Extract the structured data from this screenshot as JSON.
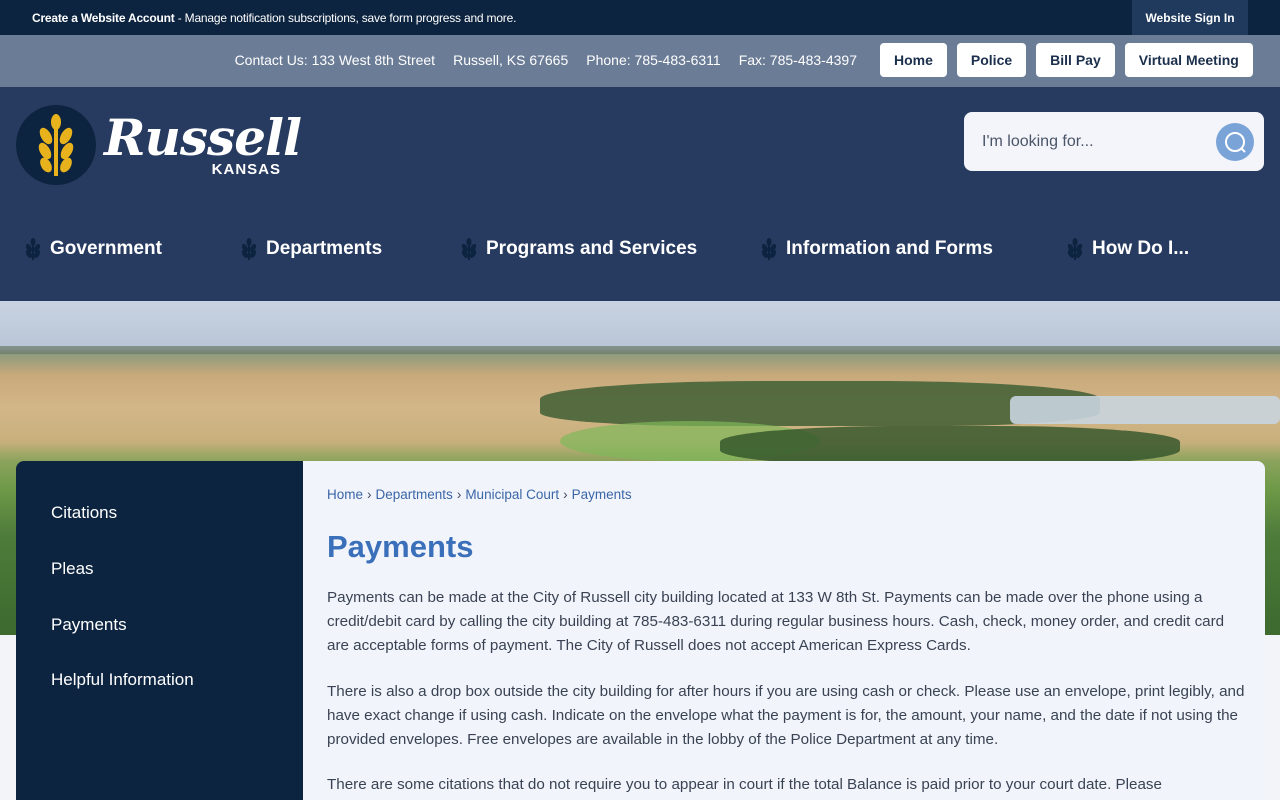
{
  "topbar": {
    "promo_bold": "Create a Website Account",
    "promo_rest": " - Manage notification subscriptions, save form progress and more.",
    "signin_label": "Website Sign In"
  },
  "contact": {
    "address": "Contact Us: 133 West 8th Street",
    "city": "Russell, KS 67665",
    "phone": "Phone: 785-483-6311",
    "fax": "Fax: 785-483-4397"
  },
  "quicklinks": [
    "Home",
    "Police",
    "Bill Pay",
    "Virtual Meeting"
  ],
  "logo": {
    "name": "Russell",
    "state": "KANSAS"
  },
  "search": {
    "placeholder": "I'm looking for..."
  },
  "nav": [
    "Government",
    "Departments",
    "Programs and Services",
    "Information and Forms",
    "How Do I..."
  ],
  "sidebar": [
    "Citations",
    "Pleas",
    "Payments",
    "Helpful Information"
  ],
  "breadcrumb": [
    "Home",
    "Departments",
    "Municipal Court",
    "Payments"
  ],
  "page": {
    "title": "Payments",
    "paragraphs": [
      "Payments can be made at the City of Russell city building located at 133 W 8th St. Payments can be made over the phone using a credit/debit card by calling the city building at 785-483-6311 during regular business hours. Cash, check, money order, and credit card are acceptable forms of payment. The City of Russell does not accept American Express Cards.",
      "There is also a drop box outside the city building for after hours if you are using cash or check. Please use an envelope, print legibly, and have exact change if using cash. Indicate on the envelope what the payment is for, the amount, your name, and the date if not using the provided envelopes. Free envelopes are available in the lobby of the Police Department at any time.",
      "There are some citations that do not require you to appear in court if the total Balance is paid prior to your court date. Please"
    ]
  },
  "colors": {
    "topbar": "#0d2440",
    "contactbar": "#6b7c96",
    "header": "#273a60",
    "accent_blue": "#3a6fba",
    "wheat_gold": "#e8b21c"
  }
}
